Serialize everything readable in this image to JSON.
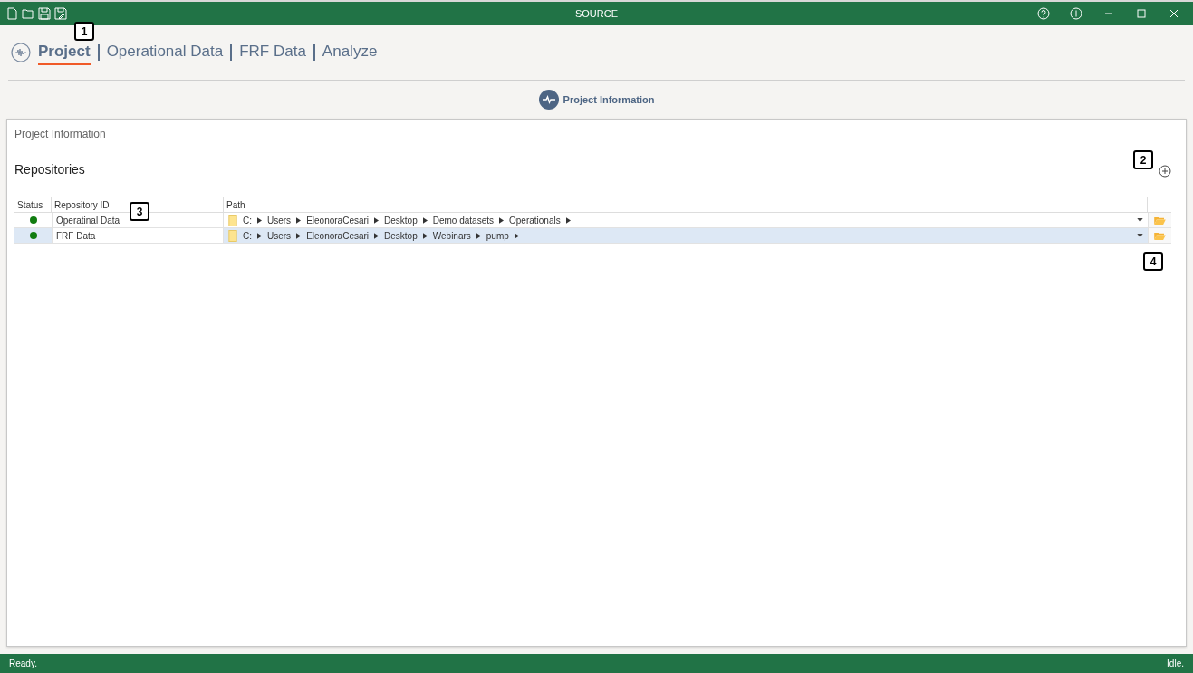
{
  "window": {
    "title": "SOURCE"
  },
  "nav_tabs": [
    {
      "label": "Project",
      "selected": true
    },
    {
      "label": "Operational Data",
      "selected": false
    },
    {
      "label": "FRF Data",
      "selected": false
    },
    {
      "label": "Analyze",
      "selected": false
    }
  ],
  "step": {
    "label": "Project Information"
  },
  "panel": {
    "title": "Project Information",
    "section_title": "Repositories",
    "table": {
      "columns": [
        "Status",
        "Repository ID",
        "Path"
      ],
      "rows": [
        {
          "color": "#107c10",
          "id": "Operatinal Data",
          "path": [
            "C:",
            "Users",
            "EleonoraCesari",
            "Desktop",
            "Demo datasets",
            "Operationals"
          ],
          "selected": false
        },
        {
          "color": "#107c10",
          "id": "FRF Data",
          "path": [
            "C:",
            "Users",
            "EleonoraCesari",
            "Desktop",
            "Webinars",
            "pump"
          ],
          "selected": true
        }
      ]
    }
  },
  "callouts": [
    {
      "label": "1"
    },
    {
      "label": "2"
    },
    {
      "label": "3"
    },
    {
      "label": "4"
    }
  ],
  "status_bar": {
    "left": "Ready.",
    "right": "Idle."
  }
}
